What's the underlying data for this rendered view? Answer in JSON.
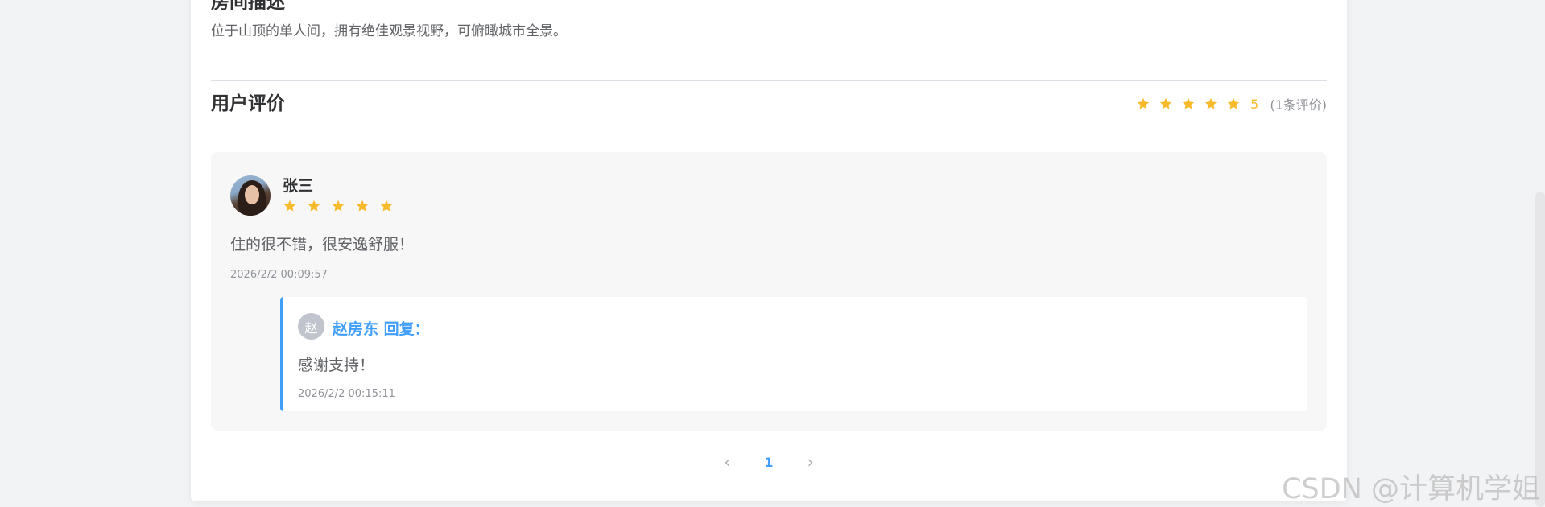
{
  "room_description": {
    "title": "房间描述",
    "text": "位于山顶的单人间，拥有绝佳观景视野，可俯瞰城市全景。"
  },
  "reviews": {
    "title": "用户评价",
    "average_score": "5",
    "count_text": "(1条评价)",
    "average_stars": 5,
    "items": [
      {
        "user": "张三",
        "rating": 5,
        "content": "住的很不错，很安逸舒服！",
        "time": "2026/2/2 00:09:57",
        "reply": {
          "avatar_initial": "赵",
          "name": "赵房东 回复：",
          "content": "感谢支持！",
          "time": "2026/2/2 00:15:11"
        }
      }
    ]
  },
  "pagination": {
    "current_page": "1",
    "prev_icon": "‹",
    "next_icon": "›"
  },
  "watermark": "CSDN @计算机学姐",
  "colors": {
    "star": "#f7ba2a",
    "accent": "#409eff"
  }
}
